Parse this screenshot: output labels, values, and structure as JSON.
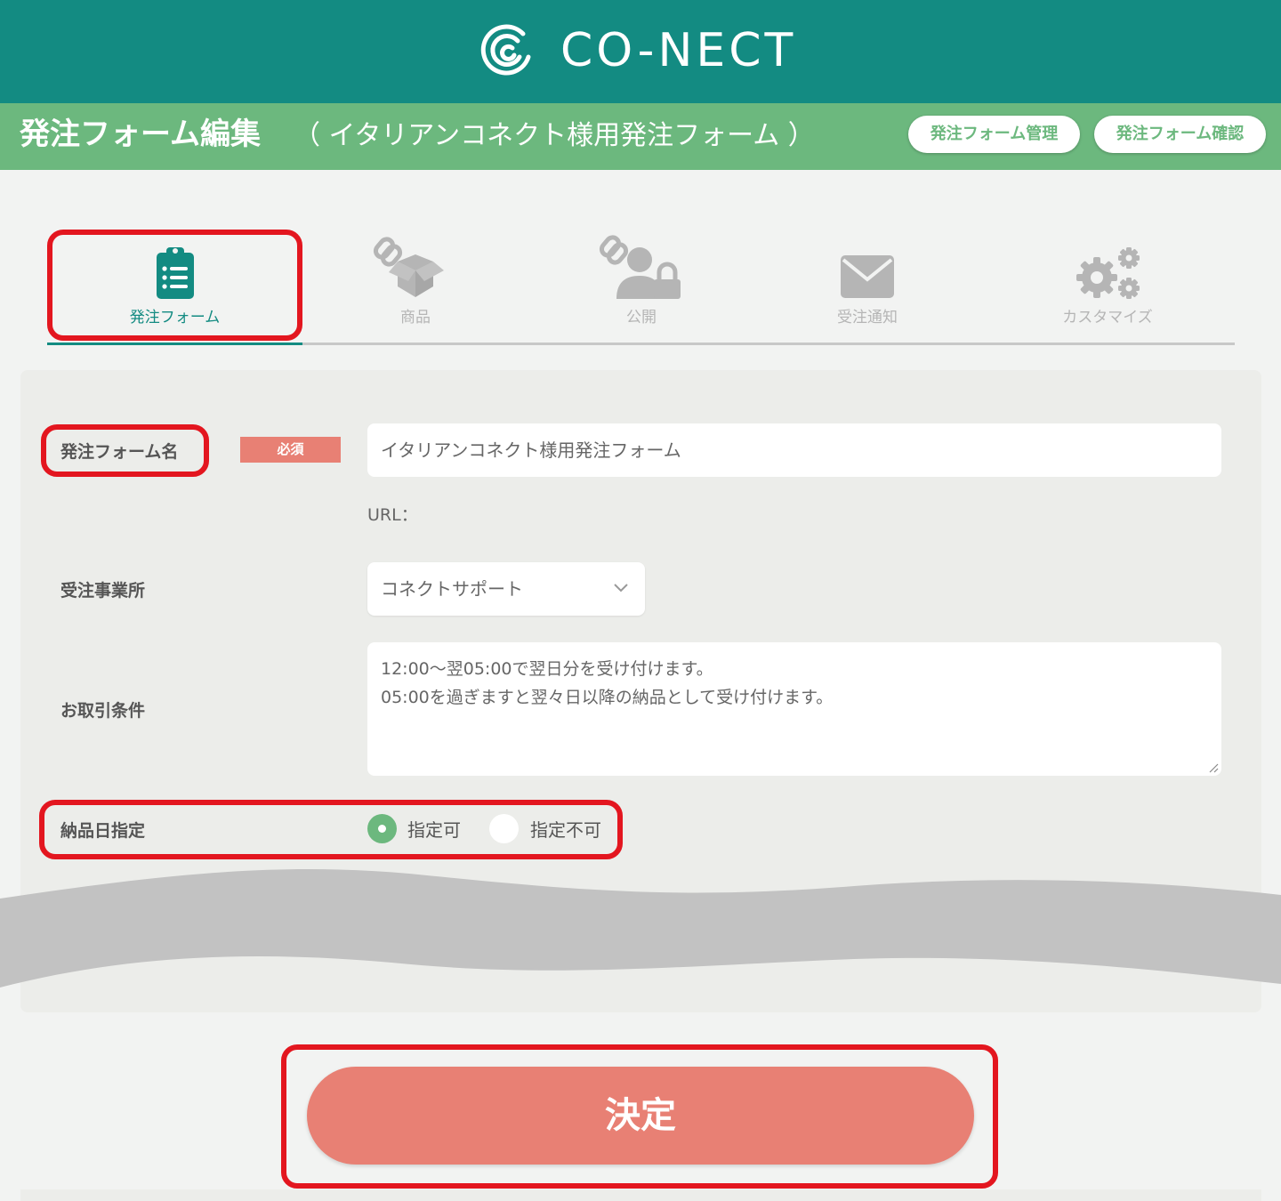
{
  "header": {
    "logo_text": "CO-NECT"
  },
  "titlebar": {
    "title": "発注フォーム編集",
    "subtitle": "（ イタリアンコネクト様用発注フォーム ）",
    "buttons": [
      "発注フォーム管理",
      "発注フォーム確認"
    ]
  },
  "tabs": [
    {
      "label": "発注フォーム",
      "icon": "clipboard-list-icon",
      "active": true
    },
    {
      "label": "商品",
      "icon": "linked-box-icon",
      "active": false
    },
    {
      "label": "公開",
      "icon": "linked-user-lock-icon",
      "active": false
    },
    {
      "label": "受注通知",
      "icon": "envelope-icon",
      "active": false
    },
    {
      "label": "カスタマイズ",
      "icon": "gears-icon",
      "active": false
    }
  ],
  "form": {
    "name_label": "発注フォーム名",
    "required_badge": "必須",
    "name_value": "イタリアンコネクト様用発注フォーム",
    "url_label": "URL：",
    "office_label": "受注事業所",
    "office_value": "コネクトサポート",
    "terms_label": "お取引条件",
    "terms_lines": [
      "12:00～翌05:00で翌日分を受け付けます。",
      "05:00を過ぎますと翌々日以降の納品として受け付けます。"
    ],
    "delivery_label": "納品日指定",
    "delivery_options": [
      {
        "label": "指定可",
        "selected": true
      },
      {
        "label": "指定不可",
        "selected": false
      }
    ]
  },
  "submit_label": "決定",
  "colors": {
    "header": "#138b82",
    "titlebar": "#6cb87e",
    "accent": "#e88074",
    "highlight": "#e3161f"
  }
}
